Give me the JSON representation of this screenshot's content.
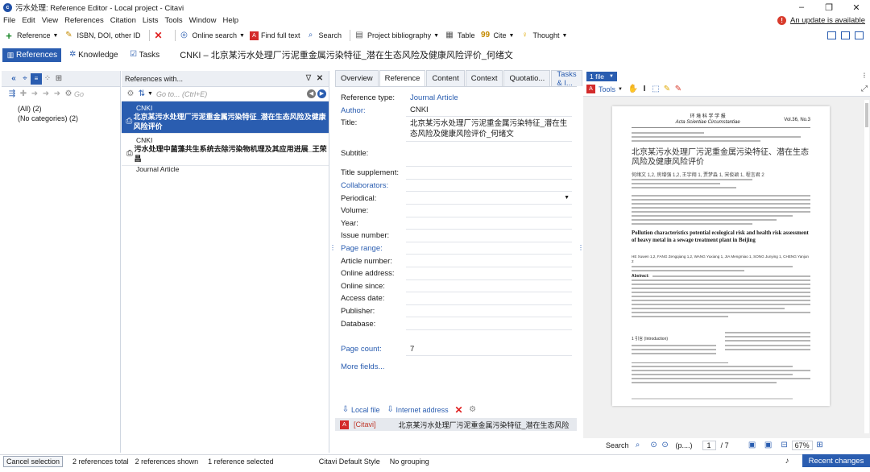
{
  "window": {
    "title": "污水处理: Reference Editor - Local project - Citavi",
    "controls": [
      "–",
      "❐",
      "✕"
    ]
  },
  "menu": [
    "File",
    "Edit",
    "View",
    "References",
    "Citation",
    "Lists",
    "Tools",
    "Window",
    "Help"
  ],
  "update_notice": "An update is available",
  "toolbar": {
    "reference": "Reference",
    "isbn": "ISBN, DOI, other ID",
    "online_search": "Online search",
    "find_full_text": "Find full text",
    "search": "Search",
    "project_bibliography": "Project bibliography",
    "table": "Table",
    "cite": "Cite",
    "thought": "Thought"
  },
  "nav": {
    "tabs": [
      "References",
      "Knowledge",
      "Tasks"
    ],
    "active": "References",
    "current_title": "CNKI – 北京某污水处理厂污泥重金属污染特征_潜在生态风险及健康风险评价_何绪文"
  },
  "categories": {
    "items": [
      {
        "label": "(All) (2)"
      },
      {
        "label": "(No categories) (2)"
      }
    ]
  },
  "reference_list": {
    "header": "References with...",
    "goto_placeholder": "Go to... (Ctrl+E)",
    "items": [
      {
        "source": "CNKI",
        "title": "北京某污水处理厂污泥重金属污染特征_潜在生态风险及健康风险评价",
        "type": "Journal Article",
        "selected": true
      },
      {
        "source": "CNKI",
        "title": "污水处理中菌藻共生系统去除污染物机理及其应用进展_王荣昌",
        "type": "Journal Article",
        "selected": false
      }
    ]
  },
  "editor": {
    "tabs": [
      "Overview",
      "Reference",
      "Content",
      "Context",
      "Quotatio...",
      "Tasks & I..."
    ],
    "active_tab": "Reference",
    "fields": [
      {
        "label": "Reference type:",
        "value": "Journal Article",
        "label_link": false,
        "value_link": true
      },
      {
        "label": "Author:",
        "value": "CNKI",
        "label_link": true,
        "value_link": false
      },
      {
        "label": "Title:",
        "value": "北京某污水处理厂污泥重金属污染特征_潜在生态风险及健康风险评价_何绪文",
        "label_link": false,
        "value_link": false
      },
      {
        "label": "Subtitle:",
        "value": "",
        "label_link": false,
        "value_link": false
      },
      {
        "label": "Title supplement:",
        "value": "",
        "label_link": false,
        "value_link": false
      },
      {
        "label": "Collaborators:",
        "value": "",
        "label_link": true,
        "value_link": false
      },
      {
        "label": "Periodical:",
        "value": "",
        "label_link": false,
        "value_link": false
      },
      {
        "label": "Volume:",
        "value": "",
        "label_link": false,
        "value_link": false
      },
      {
        "label": "Year:",
        "value": "",
        "label_link": false,
        "value_link": false
      },
      {
        "label": "Issue number:",
        "value": "",
        "label_link": false,
        "value_link": false
      },
      {
        "label": "Page range:",
        "value": "",
        "label_link": true,
        "value_link": false
      },
      {
        "label": "Article number:",
        "value": "",
        "label_link": false,
        "value_link": false
      },
      {
        "label": "Online address:",
        "value": "",
        "label_link": false,
        "value_link": false
      },
      {
        "label": "Online since:",
        "value": "",
        "label_link": false,
        "value_link": false
      },
      {
        "label": "Access date:",
        "value": "",
        "label_link": false,
        "value_link": false
      },
      {
        "label": "Publisher:",
        "value": "",
        "label_link": false,
        "value_link": false
      },
      {
        "label": "Database:",
        "value": "",
        "label_link": false,
        "value_link": false
      }
    ],
    "page_count_label": "Page count:",
    "page_count_value": "7",
    "more_fields": "More fields...",
    "local_file": "Local file",
    "internet_address": "Internet address",
    "attachment_tag": "[Citavi]",
    "attachment_name": "北京某污水处理厂污泥重金属污染特征_潜在生态风险"
  },
  "viewer": {
    "file_tab": "1 file",
    "tools": "Tools",
    "search_label": "Search",
    "page_placeholder": "(p....)",
    "page_current": "1",
    "page_total": "/ 7",
    "zoom": "67%",
    "pdf": {
      "journal_cn": "环 境 科 学 学 报",
      "journal_en": "Acta Scientiae Circumstantiae",
      "issue": "Vol.36, No.3",
      "title_cn": "北京某污水处理厂污泥重金属污染特征、潜在生态风险及健康风险评价",
      "authors_cn": "何绪文 1,2, 房增强 1,2, 王宇翔 1, 贾梦淼 1, 宋俊颖 1, 程言君 2",
      "title_en": "Pollution characteristics potential ecological risk and health risk assessment of heavy metal in a sewage treatment plant in Beijing",
      "authors_en": "HE Xuwen 1,2, FANG Zengqiang 1,2, WANG Yuxiang 1, JIA Mengmiao 1, SONG Junying 1, CHENG Yanjun 2",
      "abstract_label": "Abstract:",
      "section": "1 引言 (Introduction)"
    }
  },
  "status": {
    "cancel_selection": "Cancel selection",
    "total": "2 references total",
    "shown": "2 references shown",
    "selected": "1 reference selected",
    "style": "Citavi Default Style",
    "grouping": "No grouping",
    "recent_changes": "Recent changes"
  },
  "colors": {
    "accent": "#2a5db0",
    "link": "#2a5db0",
    "warning": "#d83b2c",
    "delete": "#e02020"
  }
}
